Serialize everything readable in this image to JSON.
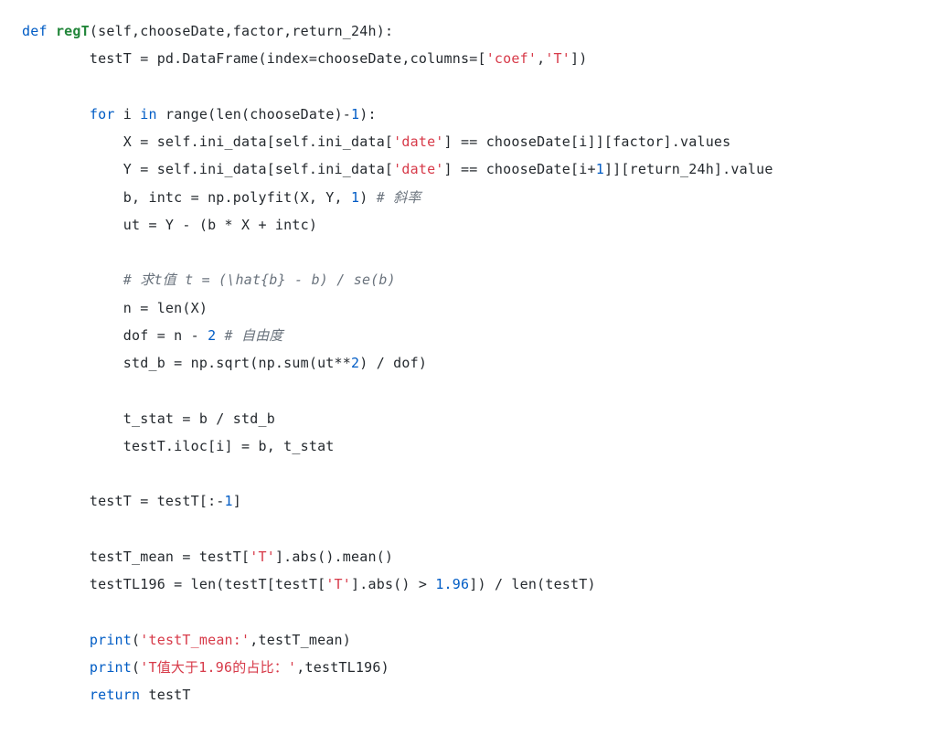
{
  "code": {
    "tokens": [
      {
        "cls": "tok-kw",
        "t": "def"
      },
      {
        "cls": "tok-pln",
        "t": " "
      },
      {
        "cls": "tok-def",
        "t": "regT"
      },
      {
        "cls": "tok-pln",
        "t": "(self,chooseDate,factor,return_24h):"
      },
      {
        "cls": "nl"
      },
      {
        "cls": "tok-pln",
        "t": "        testT = pd.DataFrame(index=chooseDate,columns=["
      },
      {
        "cls": "tok-str",
        "t": "'coef'"
      },
      {
        "cls": "tok-pln",
        "t": ","
      },
      {
        "cls": "tok-str",
        "t": "'T'"
      },
      {
        "cls": "tok-pln",
        "t": "])"
      },
      {
        "cls": "nl"
      },
      {
        "cls": "nl"
      },
      {
        "cls": "tok-pln",
        "t": "        "
      },
      {
        "cls": "tok-kw",
        "t": "for"
      },
      {
        "cls": "tok-pln",
        "t": " i "
      },
      {
        "cls": "tok-kw",
        "t": "in"
      },
      {
        "cls": "tok-pln",
        "t": " range(len(chooseDate)-"
      },
      {
        "cls": "tok-num",
        "t": "1"
      },
      {
        "cls": "tok-pln",
        "t": "):"
      },
      {
        "cls": "nl"
      },
      {
        "cls": "tok-pln",
        "t": "            X = self.ini_data[self.ini_data["
      },
      {
        "cls": "tok-str",
        "t": "'date'"
      },
      {
        "cls": "tok-pln",
        "t": "] == chooseDate[i]][factor].values"
      },
      {
        "cls": "nl"
      },
      {
        "cls": "tok-pln",
        "t": "            Y = self.ini_data[self.ini_data["
      },
      {
        "cls": "tok-str",
        "t": "'date'"
      },
      {
        "cls": "tok-pln",
        "t": "] == chooseDate[i+"
      },
      {
        "cls": "tok-num",
        "t": "1"
      },
      {
        "cls": "tok-pln",
        "t": "]][return_24h].value"
      },
      {
        "cls": "nl"
      },
      {
        "cls": "tok-pln",
        "t": "            b, intc = np.polyfit(X, Y, "
      },
      {
        "cls": "tok-num",
        "t": "1"
      },
      {
        "cls": "tok-pln",
        "t": ") "
      },
      {
        "cls": "tok-cmt",
        "t": "# 斜率"
      },
      {
        "cls": "nl"
      },
      {
        "cls": "tok-pln",
        "t": "            ut = Y - (b * X + intc)"
      },
      {
        "cls": "nl"
      },
      {
        "cls": "nl"
      },
      {
        "cls": "tok-pln",
        "t": "            "
      },
      {
        "cls": "tok-cmt",
        "t": "# 求t值 t = (\\hat{b} - b) / se(b)"
      },
      {
        "cls": "nl"
      },
      {
        "cls": "tok-pln",
        "t": "            n = len(X)"
      },
      {
        "cls": "nl"
      },
      {
        "cls": "tok-pln",
        "t": "            dof = n - "
      },
      {
        "cls": "tok-num",
        "t": "2"
      },
      {
        "cls": "tok-pln",
        "t": " "
      },
      {
        "cls": "tok-cmt",
        "t": "# 自由度"
      },
      {
        "cls": "nl"
      },
      {
        "cls": "tok-pln",
        "t": "            std_b = np.sqrt(np.sum(ut**"
      },
      {
        "cls": "tok-num",
        "t": "2"
      },
      {
        "cls": "tok-pln",
        "t": ") / dof)"
      },
      {
        "cls": "nl"
      },
      {
        "cls": "nl"
      },
      {
        "cls": "tok-pln",
        "t": "            t_stat = b / std_b"
      },
      {
        "cls": "nl"
      },
      {
        "cls": "tok-pln",
        "t": "            testT.iloc[i] = b, t_stat"
      },
      {
        "cls": "nl"
      },
      {
        "cls": "nl"
      },
      {
        "cls": "tok-pln",
        "t": "        testT = testT[:-"
      },
      {
        "cls": "tok-num",
        "t": "1"
      },
      {
        "cls": "tok-pln",
        "t": "]"
      },
      {
        "cls": "nl"
      },
      {
        "cls": "nl"
      },
      {
        "cls": "tok-pln",
        "t": "        testT_mean = testT["
      },
      {
        "cls": "tok-str",
        "t": "'T'"
      },
      {
        "cls": "tok-pln",
        "t": "].abs().mean()"
      },
      {
        "cls": "nl"
      },
      {
        "cls": "tok-pln",
        "t": "        testTL196 = len(testT[testT["
      },
      {
        "cls": "tok-str",
        "t": "'T'"
      },
      {
        "cls": "tok-pln",
        "t": "].abs() > "
      },
      {
        "cls": "tok-num",
        "t": "1.96"
      },
      {
        "cls": "tok-pln",
        "t": "]) / len(testT)"
      },
      {
        "cls": "nl"
      },
      {
        "cls": "nl"
      },
      {
        "cls": "tok-pln",
        "t": "        "
      },
      {
        "cls": "tok-kw",
        "t": "print"
      },
      {
        "cls": "tok-pln",
        "t": "("
      },
      {
        "cls": "tok-str",
        "t": "'testT_mean:'"
      },
      {
        "cls": "tok-pln",
        "t": ",testT_mean)"
      },
      {
        "cls": "nl"
      },
      {
        "cls": "tok-pln",
        "t": "        "
      },
      {
        "cls": "tok-kw",
        "t": "print"
      },
      {
        "cls": "tok-pln",
        "t": "("
      },
      {
        "cls": "tok-str",
        "t": "'T值大于1.96的占比：'"
      },
      {
        "cls": "tok-pln",
        "t": ",testTL196)"
      },
      {
        "cls": "nl"
      },
      {
        "cls": "tok-pln",
        "t": "        "
      },
      {
        "cls": "tok-kw",
        "t": "return"
      },
      {
        "cls": "tok-pln",
        "t": " testT"
      }
    ]
  }
}
